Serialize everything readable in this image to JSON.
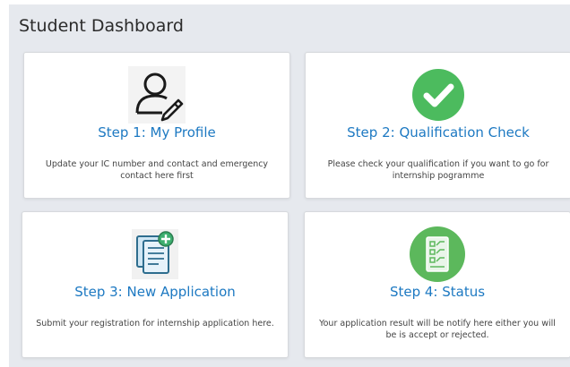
{
  "header": {
    "title": "Student Dashboard"
  },
  "cards": [
    {
      "title": "Step 1: My Profile",
      "description": "Update your IC number and contact and emergency contact here first",
      "icon": "user-edit-icon"
    },
    {
      "title": "Step 2: Qualification Check",
      "description": "Please check your qualification if you want to go for internship pogramme",
      "icon": "check-circle-icon"
    },
    {
      "title": "Step 3: New Application",
      "description": "Submit your registration for internship application here.",
      "icon": "new-document-icon"
    },
    {
      "title": "Step 4: Status",
      "description": "Your application result will be notify here either you will be is accept or rejected.",
      "icon": "checklist-icon"
    }
  ],
  "colors": {
    "background": "#e6e9ee",
    "card": "#ffffff",
    "title_link": "#1d79c2",
    "success_green": "#4cbb5e",
    "checklist_green": "#5cb85c"
  }
}
